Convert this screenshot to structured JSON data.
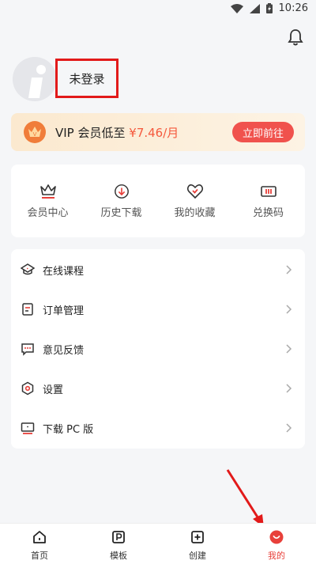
{
  "status": {
    "time": "10:26"
  },
  "profile": {
    "username": "未登录"
  },
  "vip": {
    "prefix": "VIP 会员低至 ",
    "price": "¥7.46/月",
    "button": "立即前往"
  },
  "actions": [
    {
      "label": "会员中心",
      "icon": "crown-icon"
    },
    {
      "label": "历史下载",
      "icon": "download-circle-icon"
    },
    {
      "label": "我的收藏",
      "icon": "heart-icon"
    },
    {
      "label": "兑换码",
      "icon": "ticket-icon"
    }
  ],
  "menu": [
    {
      "label": "在线课程",
      "icon": "course-icon"
    },
    {
      "label": "订单管理",
      "icon": "order-icon"
    },
    {
      "label": "意见反馈",
      "icon": "feedback-icon"
    },
    {
      "label": "设置",
      "icon": "settings-icon"
    },
    {
      "label": "下载 PC 版",
      "icon": "monitor-icon"
    }
  ],
  "tabs": [
    {
      "label": "首页",
      "icon": "home-icon"
    },
    {
      "label": "模板",
      "icon": "template-icon"
    },
    {
      "label": "创建",
      "icon": "plus-square-icon"
    },
    {
      "label": "我的",
      "icon": "profile-icon",
      "active": true
    }
  ],
  "colors": {
    "accent": "#f0524d",
    "active_tab": "#e8403a",
    "vip_price": "#f5593d",
    "annotation_red": "#e21a1a"
  }
}
